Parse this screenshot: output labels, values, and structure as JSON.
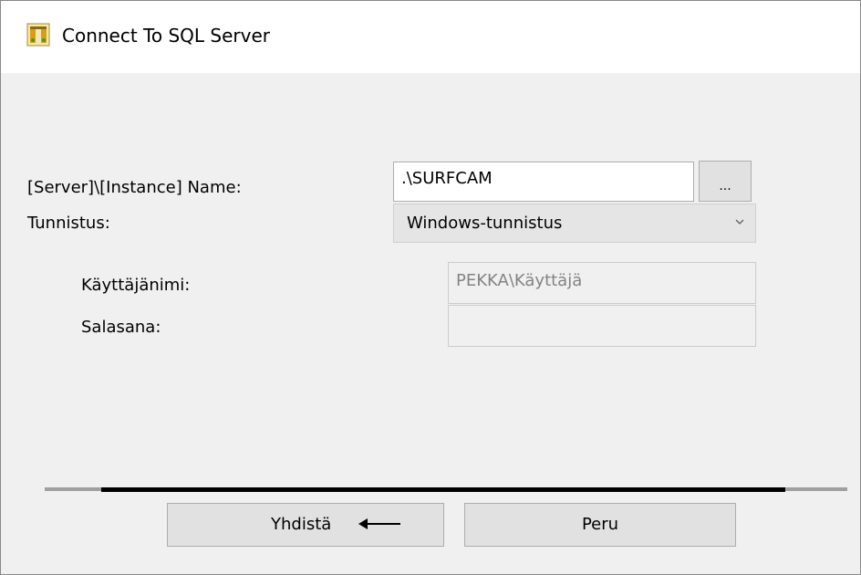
{
  "window": {
    "title": "Connect To SQL Server",
    "icon": "sql-server-icon"
  },
  "form": {
    "server_label": "[Server]\\[Instance] Name:",
    "server_value": ".\\SURFCAM",
    "browse_label": "...",
    "auth_label": "Tunnistus:",
    "auth_selected": "Windows-tunnistus",
    "username_label": "Käyttäjänimi:",
    "username_value": "PEKKA\\Käyttäjä",
    "password_label": "Salasana:",
    "password_value": ""
  },
  "buttons": {
    "connect_label": "Yhdistä",
    "cancel_label": "Peru"
  },
  "colors": {
    "titlebar": "#ffffff",
    "background": "#f0f0f0",
    "button_face": "#e1e1e1",
    "disabled_text": "#838383"
  }
}
